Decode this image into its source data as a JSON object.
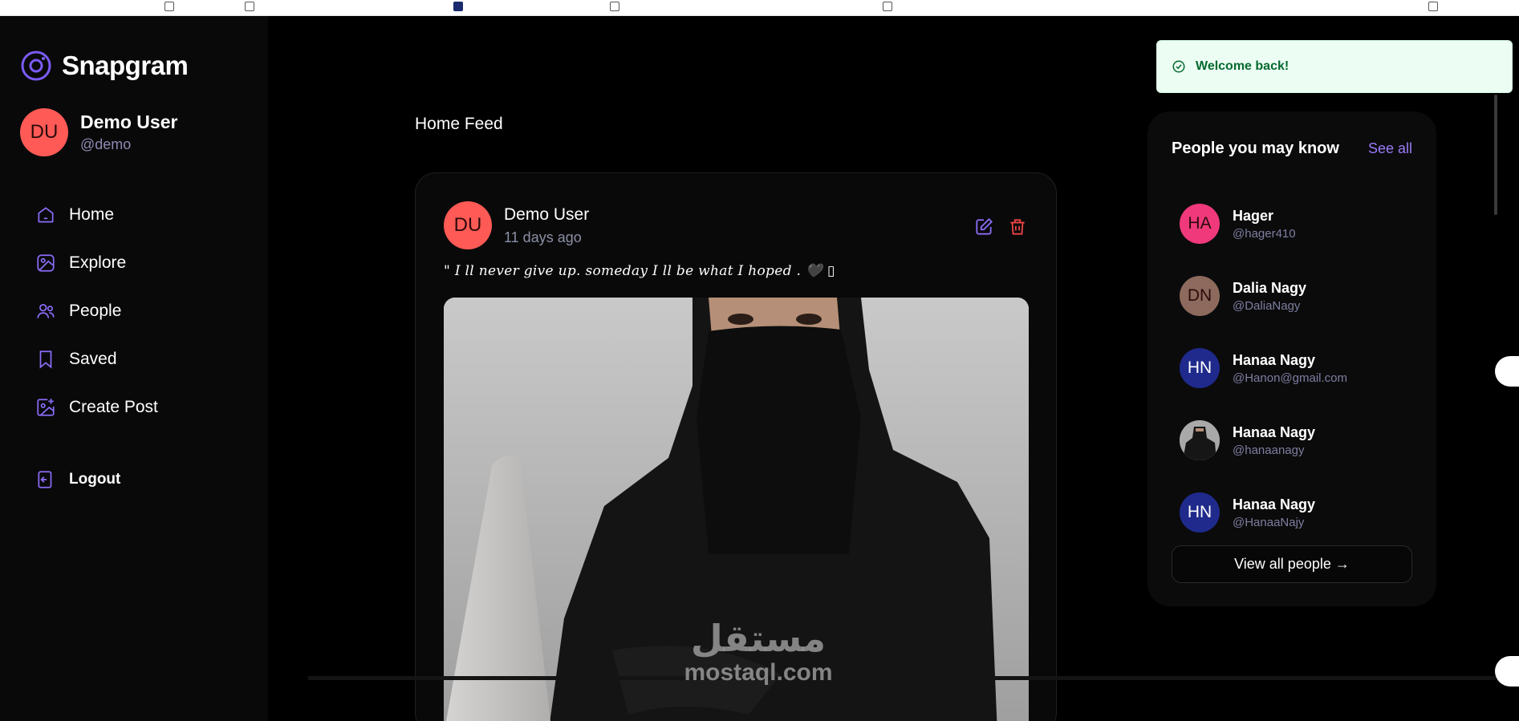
{
  "app": {
    "name": "Snapgram"
  },
  "user": {
    "initials": "DU",
    "name": "Demo User",
    "handle": "@demo"
  },
  "nav": {
    "items": [
      {
        "label": "Home",
        "icon": "home-icon"
      },
      {
        "label": "Explore",
        "icon": "explore-icon"
      },
      {
        "label": "People",
        "icon": "people-icon"
      },
      {
        "label": "Saved",
        "icon": "bookmark-icon"
      },
      {
        "label": "Create Post",
        "icon": "create-post-icon"
      }
    ],
    "logout": "Logout"
  },
  "feed": {
    "title": "Home Feed",
    "post": {
      "author_initials": "DU",
      "author": "Demo User",
      "time": "11 days ago",
      "caption": "\" I ll never give up. someday I ll be what I hoped . 🖤 ▯"
    }
  },
  "suggestions": {
    "title": "People you may know",
    "see_all": "See all",
    "people": [
      {
        "initials": "HA",
        "name": "Hager",
        "handle": "@hager410",
        "color": "#f0397a",
        "photo": false
      },
      {
        "initials": "DN",
        "name": "Dalia Nagy",
        "handle": "@DaliaNagy",
        "color": "#8d6a5d",
        "photo": false
      },
      {
        "initials": "HN",
        "name": "Hanaa Nagy",
        "handle": "@Hanon@gmail.com",
        "color": "#1f2a8c",
        "photo": false
      },
      {
        "initials": "",
        "name": "Hanaa Nagy",
        "handle": "@hanaanagy",
        "color": "#9a9a9a",
        "photo": true
      },
      {
        "initials": "HN",
        "name": "Hanaa Nagy",
        "handle": "@HanaaNajy",
        "color": "#1f2a8c",
        "photo": false
      }
    ],
    "view_all": "View all people →"
  },
  "toast": {
    "message": "Welcome back!"
  },
  "watermark": {
    "arabic": "مستقل",
    "latin": "mostaql.com"
  },
  "colors": {
    "accent": "#8b6cf6",
    "danger": "#ef4444",
    "avatar": "#ff5a55",
    "success": "#05692f"
  }
}
